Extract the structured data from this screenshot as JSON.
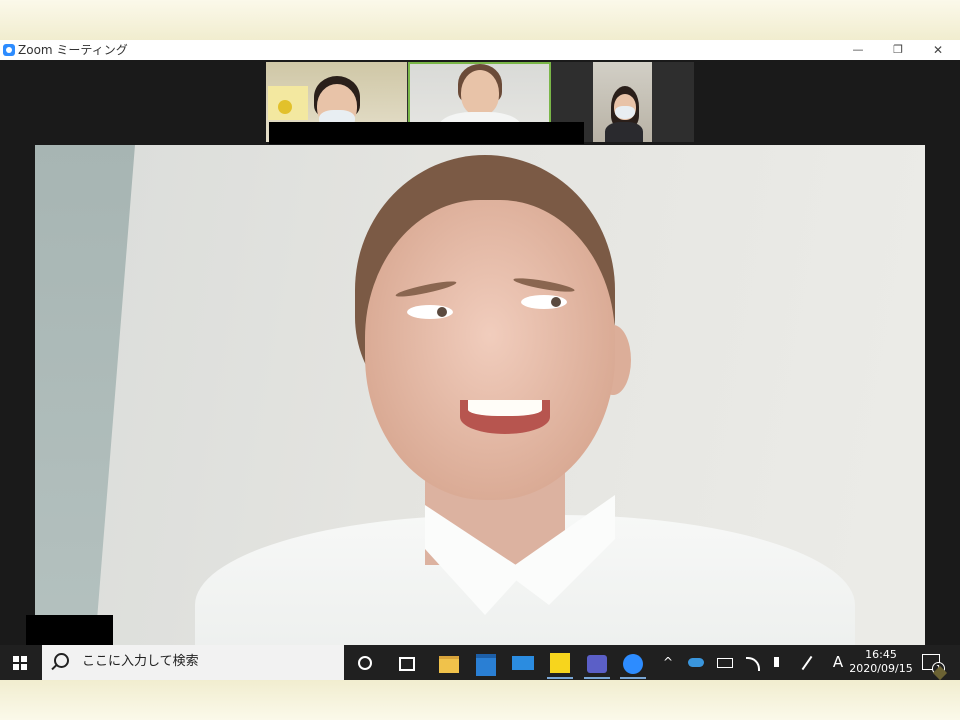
{
  "window": {
    "title": "Zoom ミーティング",
    "controls": {
      "minimize": "—",
      "maximize": "❐",
      "close": "✕"
    }
  },
  "gallery": {
    "participants": [
      {
        "kind": "student-masked"
      },
      {
        "kind": "active-speaker"
      },
      {
        "kind": "student-masked"
      }
    ]
  },
  "taskbar": {
    "search_placeholder": "ここに入力して検索",
    "tray": {
      "ime": "A"
    },
    "clock": {
      "time": "16:45",
      "date": "2020/09/15"
    },
    "notification_count": "1"
  },
  "colors": {
    "taskbar": "#202020",
    "zoom_accent": "#2d8cff",
    "speaker_border": "#7ab648"
  }
}
